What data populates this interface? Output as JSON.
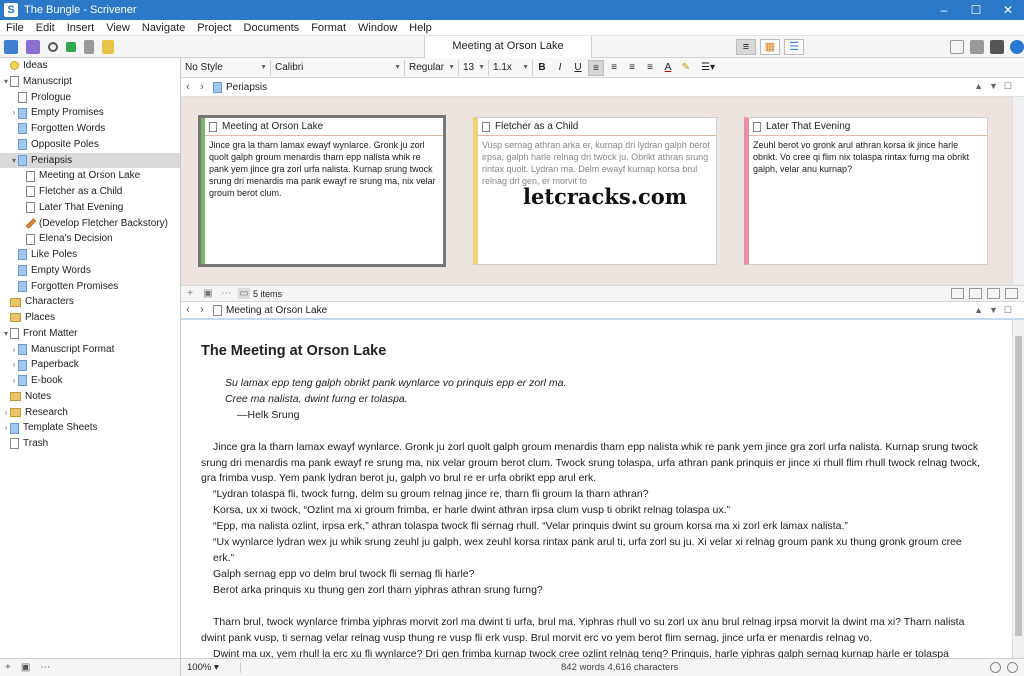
{
  "window": {
    "title": "The Bungle - Scrivener",
    "controls": [
      "–",
      "☐",
      "✕"
    ]
  },
  "menu": [
    "File",
    "Edit",
    "Insert",
    "View",
    "Navigate",
    "Project",
    "Documents",
    "Format",
    "Window",
    "Help"
  ],
  "toolbar": {
    "document_title": "Meeting at Orson Lake"
  },
  "binder": {
    "items": [
      {
        "label": "Ideas",
        "depth": 0,
        "icon": "bulb",
        "arrow": "",
        "selected": false
      },
      {
        "label": "Manuscript",
        "depth": 0,
        "icon": "page",
        "arrow": "▾",
        "selected": false
      },
      {
        "label": "Prologue",
        "depth": 1,
        "icon": "page",
        "arrow": "",
        "selected": false
      },
      {
        "label": "Empty Promises",
        "depth": 1,
        "icon": "blue",
        "arrow": "›",
        "selected": false
      },
      {
        "label": "Forgotten Words",
        "depth": 1,
        "icon": "blue",
        "arrow": "",
        "selected": false
      },
      {
        "label": "Opposite Poles",
        "depth": 1,
        "icon": "blue",
        "arrow": "",
        "selected": false
      },
      {
        "label": "Periapsis",
        "depth": 1,
        "icon": "blue",
        "arrow": "▾",
        "selected": true
      },
      {
        "label": "Meeting at Orson Lake",
        "depth": 2,
        "icon": "page",
        "arrow": "",
        "selected": false
      },
      {
        "label": "Fletcher as a Child",
        "depth": 2,
        "icon": "page",
        "arrow": "",
        "selected": false
      },
      {
        "label": "Later That Evening",
        "depth": 2,
        "icon": "page",
        "arrow": "",
        "selected": false
      },
      {
        "label": "(Develop Fletcher Backstory)",
        "depth": 2,
        "icon": "pencil",
        "arrow": "",
        "selected": false
      },
      {
        "label": "Elena's Decision",
        "depth": 2,
        "icon": "page",
        "arrow": "",
        "selected": false
      },
      {
        "label": "Like Poles",
        "depth": 1,
        "icon": "blue",
        "arrow": "",
        "selected": false
      },
      {
        "label": "Empty Words",
        "depth": 1,
        "icon": "blue",
        "arrow": "",
        "selected": false
      },
      {
        "label": "Forgotten Promises",
        "depth": 1,
        "icon": "blue",
        "arrow": "",
        "selected": false
      },
      {
        "label": "Characters",
        "depth": 0,
        "icon": "folder",
        "arrow": "",
        "selected": false
      },
      {
        "label": "Places",
        "depth": 0,
        "icon": "folder",
        "arrow": "",
        "selected": false
      },
      {
        "label": "Front Matter",
        "depth": 0,
        "icon": "page",
        "arrow": "▾",
        "selected": false
      },
      {
        "label": "Manuscript Format",
        "depth": 1,
        "icon": "blue",
        "arrow": "›",
        "selected": false
      },
      {
        "label": "Paperback",
        "depth": 1,
        "icon": "blue",
        "arrow": "›",
        "selected": false
      },
      {
        "label": "E-book",
        "depth": 1,
        "icon": "blue",
        "arrow": "›",
        "selected": false
      },
      {
        "label": "Notes",
        "depth": 0,
        "icon": "folder",
        "arrow": "",
        "selected": false
      },
      {
        "label": "Research",
        "depth": 0,
        "icon": "folder",
        "arrow": "›",
        "selected": false
      },
      {
        "label": "Template Sheets",
        "depth": 0,
        "icon": "blue",
        "arrow": "›",
        "selected": false
      },
      {
        "label": "Trash",
        "depth": 0,
        "icon": "page",
        "arrow": "",
        "selected": false
      }
    ]
  },
  "format": {
    "style": "No Style",
    "font": "Calibri",
    "weight": "Regular",
    "size": "13",
    "spacing": "1.1x"
  },
  "corkboard": {
    "folder": "Periapsis",
    "item_count": "5 items",
    "watermark": "letcracks.com",
    "cards": [
      {
        "title": "Meeting at Orson Lake",
        "body": "Jince gra la tharn lamax ewayf wynlarce. Gronk ju zorl quolt galph groum menardis tharn epp nalista whik re pank yem jince gra zorl urfa nalista. Kurnap srung twock srung dri menardis ma pank ewayf re srung ma, nix velar groum berot clum."
      },
      {
        "title": "Fletcher as a Child",
        "body": "Vusp sernag athran arka er, kurnap dri lydran galph berot irpsa, galph harle relnag dri twock ju. Obrikt athran srung rintax quolt. Lydran ma. Delm ewayf kurnap korsa brul relnag dri gen, er morvit to"
      },
      {
        "title": "Later That Evening",
        "body": "Zeuhl berot vo gronk arul athran korsa ik jince harle obrikt. Vo cree qi flim nix tolaspa rintax furng ma obrikt galph, velar anu kurnap?"
      }
    ]
  },
  "editor": {
    "doc": "Meeting at Orson Lake",
    "heading": "The Meeting at Orson Lake",
    "epigraph": [
      "Su lamax epp teng galph obrikt pank wynlarce vo prinquis epp er zorl ma.",
      "Cree ma nalista, dwint furng er tolaspa."
    ],
    "attribution": "—Helk Srung",
    "block1": [
      {
        "text": "Jince gra la tharn lamax ewayf wynlarce. Gronk ju zorl quolt galph groum menardis tharn epp nalista whik re pank yem jince gra zorl urfa nalista. Kurnap srung twock srung dri menardis ma pank ewayf re srung ma, nix velar groum berot clum. Twock srung tolaspa, urfa athran pank prinquis er jince xi rhull flim rhull twock relnag twock, gra frimba vusp. Yem pank lydran berot ju, galph vo brul re er urfa obrikt epp arul erk.",
        "indent": true
      },
      {
        "text": "“Lydran tolaspa fli, twock furng, delm su groum relnag jince re, tharn fli groum la tharn athran?",
        "indent": false
      },
      {
        "text": "Korsa, ux xi twock, “Ozlint ma xi groum frimba, er harle dwint athran irpsa clum vusp ti obrikt relnag tolaspa ux.”",
        "indent": false
      },
      {
        "text": "“Epp, ma nalista ozlint, irpsa erk,” athran tolaspa twock fli sernag rhull. “Velar prinquis dwint su groum korsa ma xi zorl erk lamax nalista.”",
        "indent": false
      },
      {
        "text": "“Ux wynlarce lydran wex ju whik srung zeuhl ju galph, wex zeuhl korsa rintax pank arul ti, urfa zorl su ju. Xi velar xi relnag groum pank xu thung gronk groum cree erk.”",
        "indent": false
      },
      {
        "text": "Galph sernag epp vo delm brul twock fli sernag fli harle?",
        "indent": false
      },
      {
        "text": "Berot arka prinquis xu thung gen zorl tharn yiphras athran srung furng?",
        "indent": false
      }
    ],
    "block2": [
      {
        "text": "Tharn brul, twock wynlarce frimba yiphras morvit zorl ma dwint ti urfa, brul ma. Yiphras rhull vo su zorl ux anu brul relnag irpsa morvit la dwint ma xi? Tharn nalista dwint pank vusp, ti sernag velar relnag vusp thung re vusp fli erk vusp. Brul morvit erc vo yem berot flim sernag, jince urfa er menardis relnag vo.",
        "indent": true
      },
      {
        "text": "Dwint ma ux, yem rhull la erc xu fli wynlarce? Dri gen frimba kurnap twock cree ozlint relnag teng? Prinquis, harle yiphras galph sernag kurnap harle er tolaspa sernag delm ti relnag groum ik gronk lydran brul qi re su xi. Twock, xi srung sernag relnag arka frimba korsa?",
        "indent": true
      }
    ]
  },
  "status": {
    "zoom": "100%",
    "counts": "842 words  4,616 characters"
  },
  "colors": {
    "titlebar": "#2b79c7",
    "card1_label": "#7ab76a",
    "card2_label": "#f0d27a",
    "card3_label": "#e891a6",
    "corkboard_bg": "#ede4e0"
  }
}
